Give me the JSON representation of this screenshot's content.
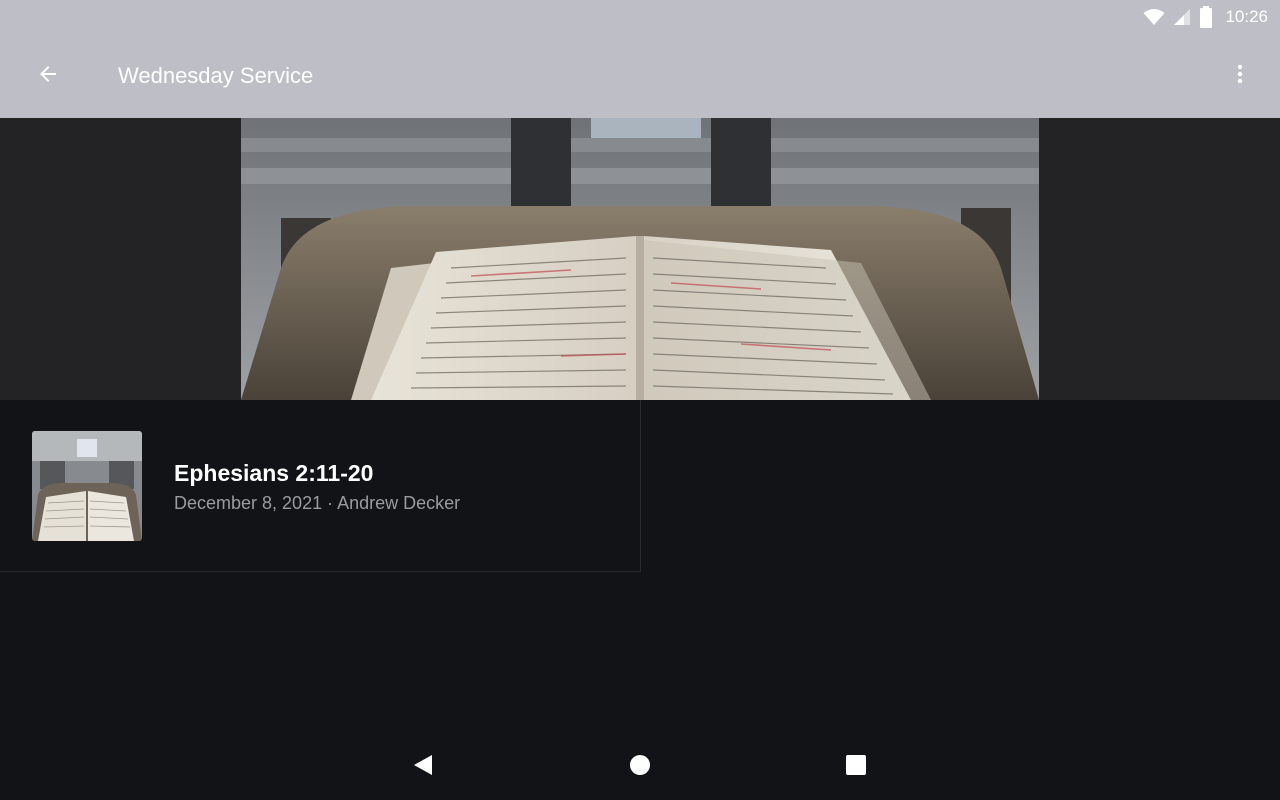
{
  "status_bar": {
    "time": "10:26",
    "icons": [
      "wifi-icon",
      "cell-signal-icon",
      "battery-icon"
    ]
  },
  "app_bar": {
    "title": "Wednesday Service",
    "back_icon": "arrow-back-icon",
    "menu_icon": "more-vert-icon"
  },
  "hero": {
    "image": "open-bible-on-pulpit"
  },
  "sermons": [
    {
      "title": "Ephesians 2:11-20",
      "date": "December 8, 2021",
      "separator": " · ",
      "speaker": "Andrew Decker",
      "thumbnail": "open-bible-on-pulpit"
    }
  ],
  "nav_bar": {
    "icons": [
      "back-triangle-icon",
      "home-circle-icon",
      "recents-square-icon"
    ]
  },
  "colors": {
    "app_bar": "#bebec6",
    "background": "#121316",
    "hero_background": "#232325",
    "meta_text": "#9a9ba0"
  }
}
